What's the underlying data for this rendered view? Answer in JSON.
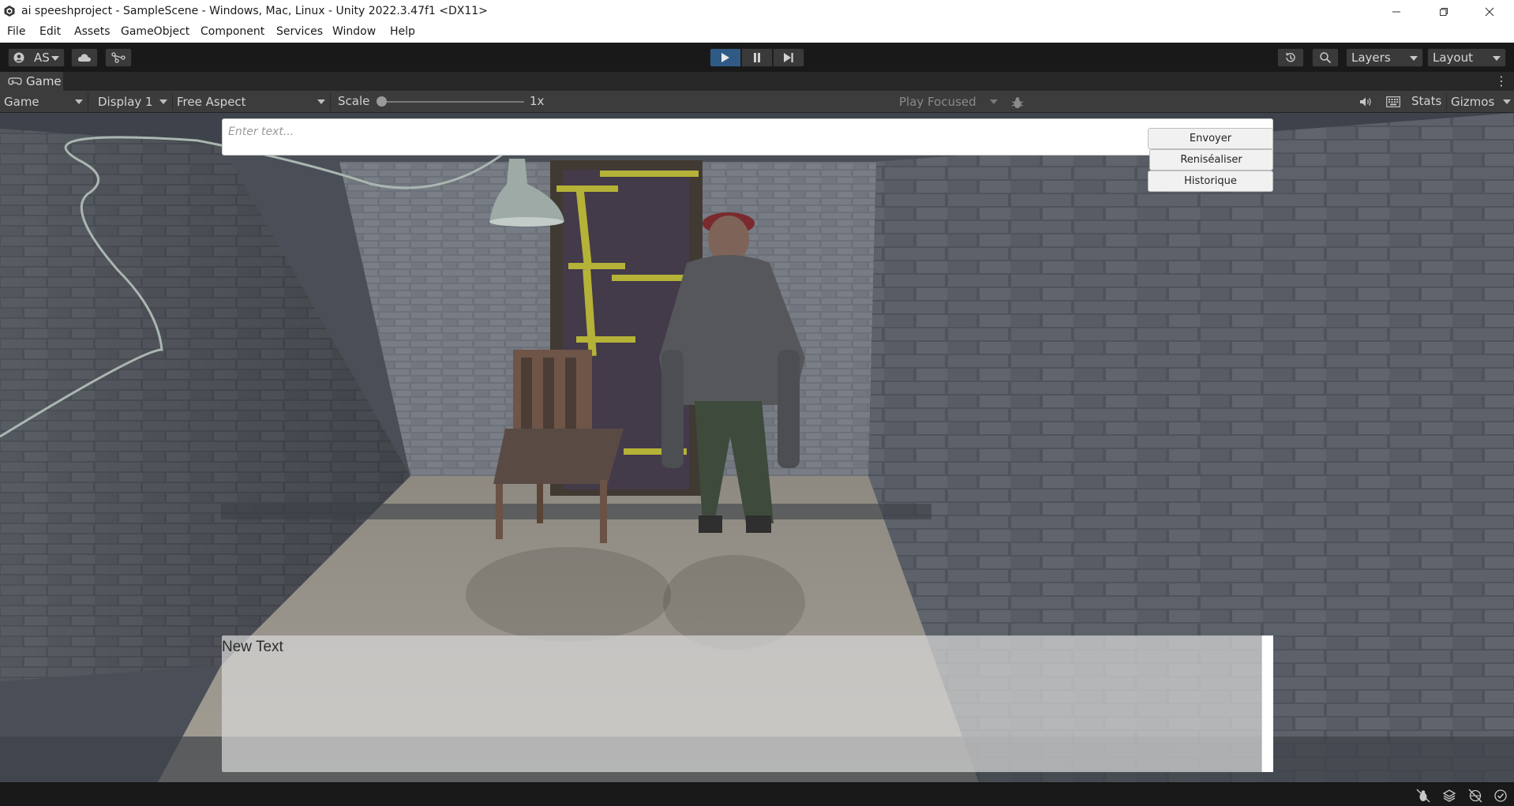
{
  "window": {
    "title": "ai speeshproject - SampleScene - Windows, Mac, Linux - Unity 2022.3.47f1 <DX11>"
  },
  "menu": [
    "File",
    "Edit",
    "Assets",
    "GameObject",
    "Component",
    "Services",
    "Window",
    "Help"
  ],
  "toolbar": {
    "account_label": "AS",
    "layers_label": "Layers",
    "layout_label": "Layout",
    "play_active": true
  },
  "tab": {
    "label": "Game"
  },
  "game_toolbar": {
    "view_mode": "Game",
    "display": "Display 1",
    "aspect": "Free Aspect",
    "scale_label": "Scale",
    "scale_value": "1x",
    "play_mode": "Play Focused",
    "stats_label": "Stats",
    "gizmos_label": "Gizmos"
  },
  "game_ui": {
    "input_placeholder": "Enter text...",
    "buttons": [
      "Envoyer",
      "Reniséaliser",
      "Historique"
    ],
    "output_text": "New Text"
  },
  "colors": {
    "accent_play": "#2f5a86",
    "editor_dark": "#191919",
    "panel_bg": "#3c3c3c"
  }
}
